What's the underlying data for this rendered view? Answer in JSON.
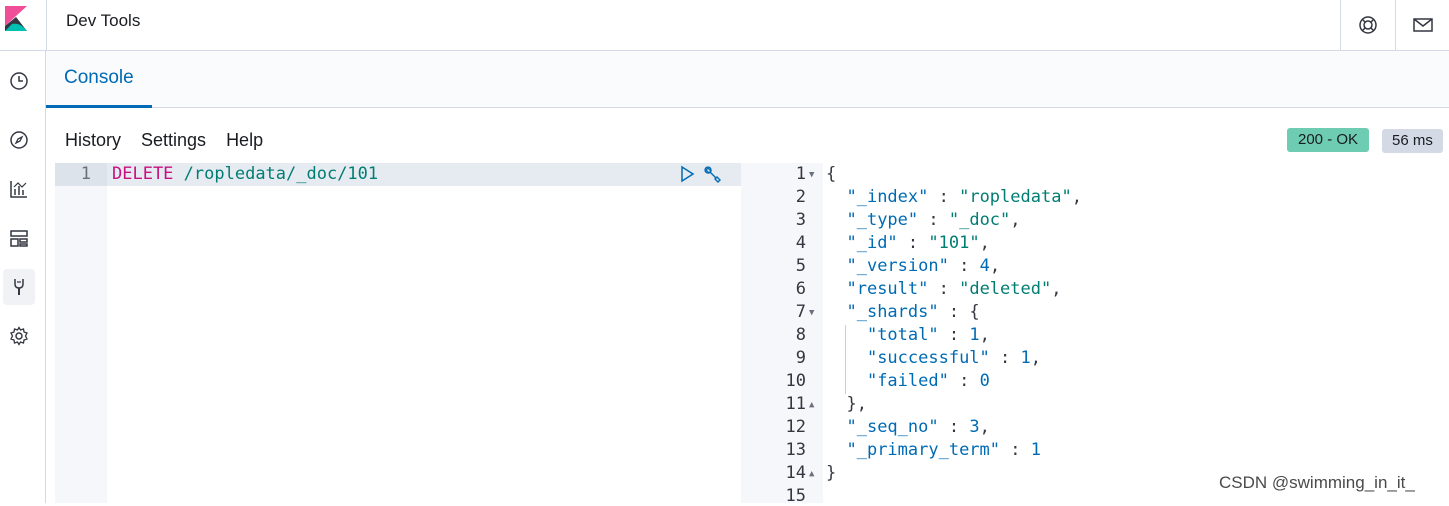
{
  "header": {
    "title": "Dev Tools"
  },
  "icons": {
    "logo": "kibana-logo",
    "help": "help-icon",
    "mail": "mail-icon",
    "nav": [
      "clock-icon",
      "compass-icon",
      "visualize-icon",
      "dashboard-icon",
      "dev-tools-icon",
      "gear-icon"
    ],
    "run": "play-icon",
    "settings": "wrench-icon"
  },
  "tabs": {
    "console": "Console"
  },
  "menu": {
    "history": "History",
    "settings": "Settings",
    "help": "Help"
  },
  "status": {
    "code": "200 - OK",
    "time": "56 ms"
  },
  "request": {
    "line_number": "1",
    "method": "DELETE",
    "path": "/ropledata/_doc/101"
  },
  "response": {
    "line_numbers": [
      "1",
      "2",
      "3",
      "4",
      "5",
      "6",
      "7",
      "8",
      "9",
      "10",
      "11",
      "12",
      "13",
      "14",
      "15"
    ],
    "line1": "{",
    "index_key": "\"_index\"",
    "index_val": "\"ropledata\"",
    "type_key": "\"_type\"",
    "type_val": "\"_doc\"",
    "id_key": "\"_id\"",
    "id_val": "\"101\"",
    "version_key": "\"_version\"",
    "version_val": "4",
    "result_key": "\"result\"",
    "result_val": "\"deleted\"",
    "shards_key": "\"_shards\"",
    "total_key": "\"total\"",
    "total_val": "1",
    "successful_key": "\"successful\"",
    "successful_val": "1",
    "failed_key": "\"failed\"",
    "failed_val": "0",
    "shards_close": "},",
    "seq_key": "\"_seq_no\"",
    "seq_val": "3",
    "term_key": "\"_primary_term\"",
    "term_val": "1",
    "line14": "}"
  },
  "watermark": "CSDN @swimming_in_it_",
  "colors": {
    "accent": "#006bb4",
    "ok_badge": "#6dccb1",
    "method": "#c8107e",
    "string": "#017d73"
  }
}
